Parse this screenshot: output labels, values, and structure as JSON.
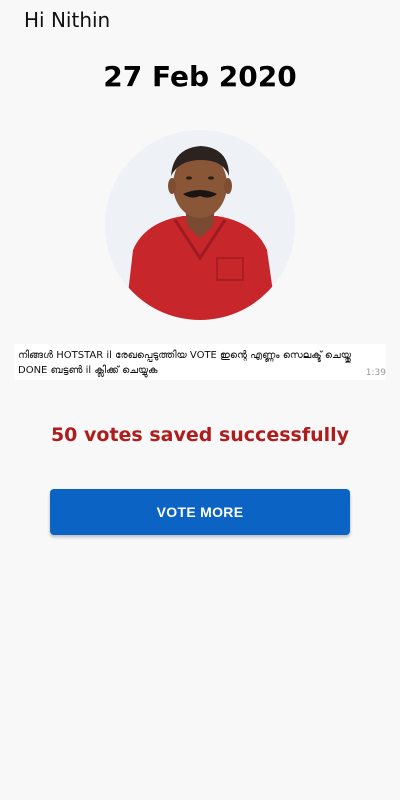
{
  "header": {
    "greeting": "Hi Nithin"
  },
  "main": {
    "date": "27 Feb 2020",
    "photo": {
      "icon": "person-portrait",
      "shirt_color": "#c7262b",
      "background_color": "#eef1f5"
    },
    "message": {
      "text": "നിങ്ങൾ HOTSTAR il  രേഖപ്പെടുത്തിയ VOTE ഇന്റെ എണ്ണം സെലക്ട് ചെയ്തു DONE ബട്ടൺ il ക്ലിക്ക് ചെയ്യുക",
      "time": "1:39"
    },
    "success_text": "50 votes saved successfully",
    "vote_more_label": "VOTE MORE"
  },
  "colors": {
    "success": "#b01c1c",
    "button": "#0b63c4",
    "background": "#f8f8f8"
  }
}
